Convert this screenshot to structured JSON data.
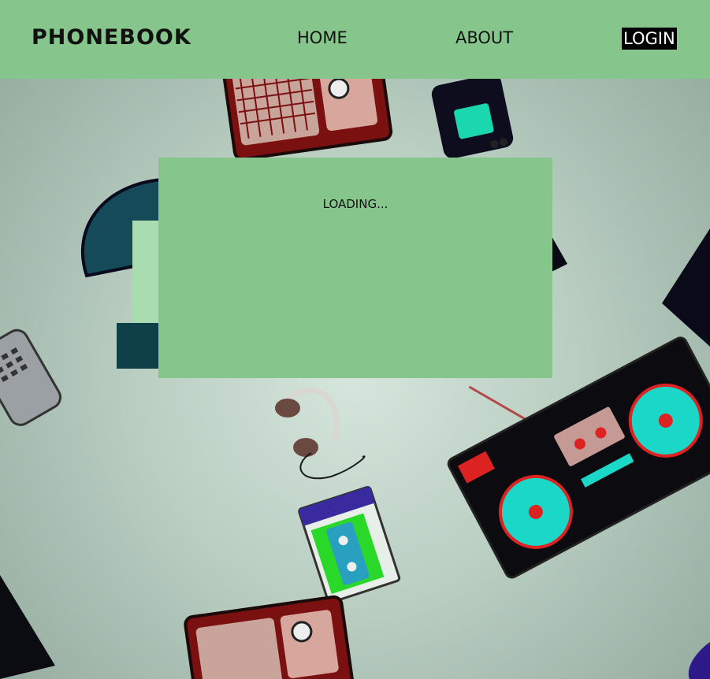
{
  "navbar": {
    "brand": "PHONEBOOK",
    "links": {
      "home": "HOME",
      "about": "ABOUT",
      "login": "LOGIN"
    }
  },
  "main": {
    "status_text": "LOADING..."
  },
  "colors": {
    "accent": "#86c68c",
    "text": "#111111",
    "login_bg": "#000000",
    "login_text": "#ffffff"
  },
  "background": {
    "icons": [
      "retro-radio-icon",
      "handheld-game-icon",
      "rotary-phone-icon",
      "cordless-phone-icon",
      "headphones-icon",
      "cassette-player-icon",
      "boombox-icon",
      "retro-radio-icon"
    ]
  }
}
